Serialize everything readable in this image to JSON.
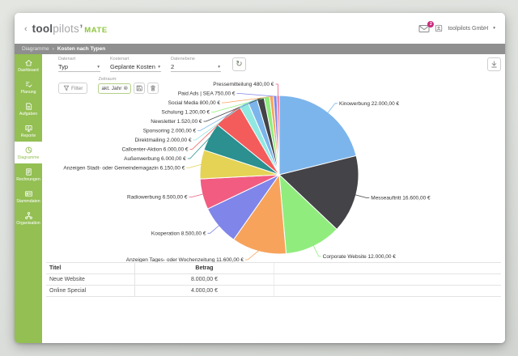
{
  "window": {
    "logo": {
      "chevron": "‹",
      "bold": "tool",
      "light": "pilots",
      "mark": "’",
      "suffix": "MATE"
    },
    "account": {
      "company": "toolpilots GmbH",
      "mail_badge": "2"
    },
    "breadcrumb": {
      "section": "Diagramme",
      "separator": "›",
      "page": "Kosten nach Typen"
    }
  },
  "icons": {
    "caret_down": "▾",
    "refresh": "↻",
    "chip_close": "⊗"
  },
  "sidebar": {
    "items": [
      {
        "label": "Dashboard",
        "icon": "home-icon",
        "active": false
      },
      {
        "label": "Planung",
        "icon": "checklist-icon",
        "active": false
      },
      {
        "label": "Aufgaben",
        "icon": "task-document-icon",
        "active": false
      },
      {
        "label": "Reporte",
        "icon": "report-screen-icon",
        "active": false
      },
      {
        "label": "Diagramme",
        "icon": "pie-chart-icon",
        "active": true
      },
      {
        "label": "Rechnungen",
        "icon": "invoice-icon",
        "active": false
      },
      {
        "label": "Stammdaten",
        "icon": "id-card-icon",
        "active": false
      },
      {
        "label": "Organisation",
        "icon": "org-chart-icon",
        "active": false
      }
    ]
  },
  "toolbar": {
    "fields": [
      {
        "label": "Datenart",
        "value": "Typ"
      },
      {
        "label": "Kostenart",
        "value": "Geplante Kosten"
      },
      {
        "label": "Datenebene",
        "value": "2"
      }
    ],
    "filter_label": "Filter",
    "zeitraum_label": "Zeitraum:",
    "zeitraum_chip": "akt. Jahr"
  },
  "chart_data": {
    "type": "pie",
    "title": "",
    "legend": "none",
    "labels_outside": true,
    "total": 104100,
    "currency": "€",
    "slices": [
      {
        "label": "Kinowerbung",
        "value": 22000,
        "display": "22.000,00 €"
      },
      {
        "label": "Messeauftritt",
        "value": 16600,
        "display": "16.600,00 €"
      },
      {
        "label": "Corporate Website",
        "value": 12000,
        "display": "12.000,00 €"
      },
      {
        "label": "Anzeigen Tages- oder Wochenzeitung",
        "value": 11600,
        "display": "11.600,00 €"
      },
      {
        "label": "Kooperation",
        "value": 8500,
        "display": "8.500,00 €"
      },
      {
        "label": "Radiowerbung",
        "value": 6500,
        "display": "6.500,00 €"
      },
      {
        "label": "Anzeigen Stadt- oder Gemeindemagazin",
        "value": 6150,
        "display": "6.150,00 €"
      },
      {
        "label": "Außenwerbung",
        "value": 6000,
        "display": "6.000,00 €"
      },
      {
        "label": "Callcenter-Aktion",
        "value": 6000,
        "display": "6.000,00 €"
      },
      {
        "label": "Direktmailing",
        "value": 2000,
        "display": "2.000,00 €"
      },
      {
        "label": "Sponsoring",
        "value": 2000,
        "display": "2.000,00 €"
      },
      {
        "label": "Newsletter",
        "value": 1520,
        "display": "1.520,00 €"
      },
      {
        "label": "Schulung",
        "value": 1200,
        "display": "1.200,00 €"
      },
      {
        "label": "Social Media",
        "value": 800,
        "display": "800,00 €"
      },
      {
        "label": "Paid Ads | SEA",
        "value": 750,
        "display": "750,00 €"
      },
      {
        "label": "Pressemitteilung",
        "value": 480,
        "display": "480,00 €"
      }
    ],
    "palette": [
      "#7cb5ec",
      "#434348",
      "#90ed7d",
      "#f7a35c",
      "#8085e9",
      "#f15c80",
      "#e4d354",
      "#2b908f",
      "#f45b5b",
      "#91e8e1"
    ],
    "label_color": "#333333"
  },
  "table": {
    "headers": [
      "Titel",
      "Betrag"
    ],
    "rows": [
      {
        "titel": "Neue Website",
        "betrag": "8.000,00 €"
      },
      {
        "titel": "Online Special",
        "betrag": "4.000,00 €"
      }
    ]
  },
  "colors": {
    "sidebar_green": "#93bf53",
    "logo_green": "#8dc63f",
    "badge_pink": "#ca2a7e",
    "breadcrumb_gray": "#8e8f8e"
  }
}
